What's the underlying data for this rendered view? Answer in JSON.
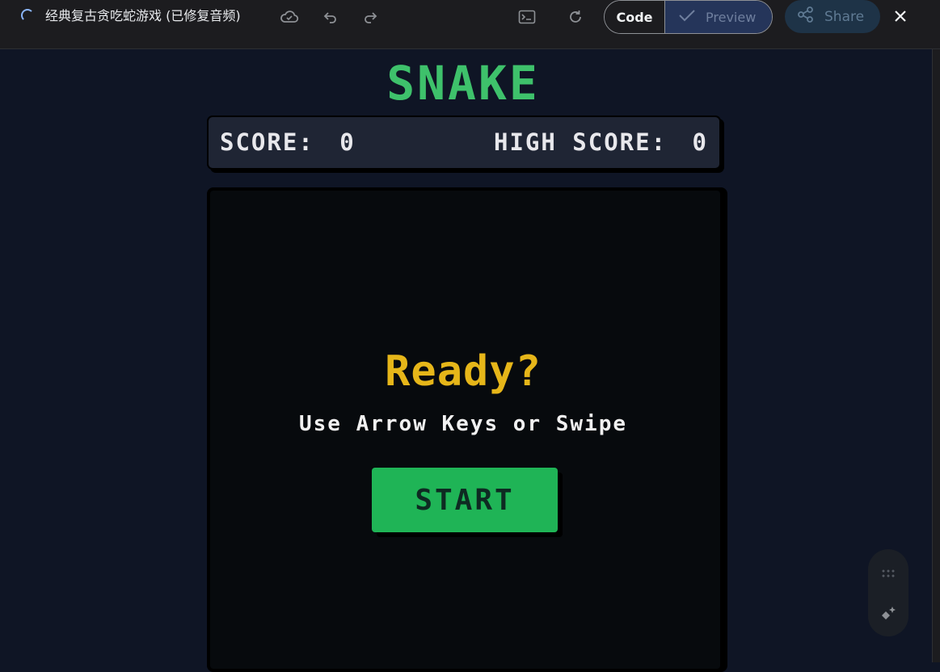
{
  "topbar": {
    "title": "经典复古贪吃蛇游戏 (已修复音频)",
    "code_label": "Code",
    "preview_label": "Preview",
    "share_label": "Share"
  },
  "game": {
    "title": "SNAKE",
    "score_label": "SCORE:",
    "score_value": "0",
    "high_score_label": "HIGH SCORE:",
    "high_score_value": "0",
    "ready_text": "Ready?",
    "hint_text": "Use Arrow Keys or Swipe",
    "start_label": "START"
  },
  "colors": {
    "accent_green": "#3ec16b",
    "ready_yellow": "#e6b619",
    "start_green": "#1fb456",
    "background": "#0f1525"
  },
  "icons": [
    "cloud-icon",
    "undo-icon",
    "redo-icon",
    "console-icon",
    "refresh-icon",
    "check-icon",
    "share-icon",
    "close-icon",
    "drag-handle-icon",
    "sparkle-icon"
  ]
}
